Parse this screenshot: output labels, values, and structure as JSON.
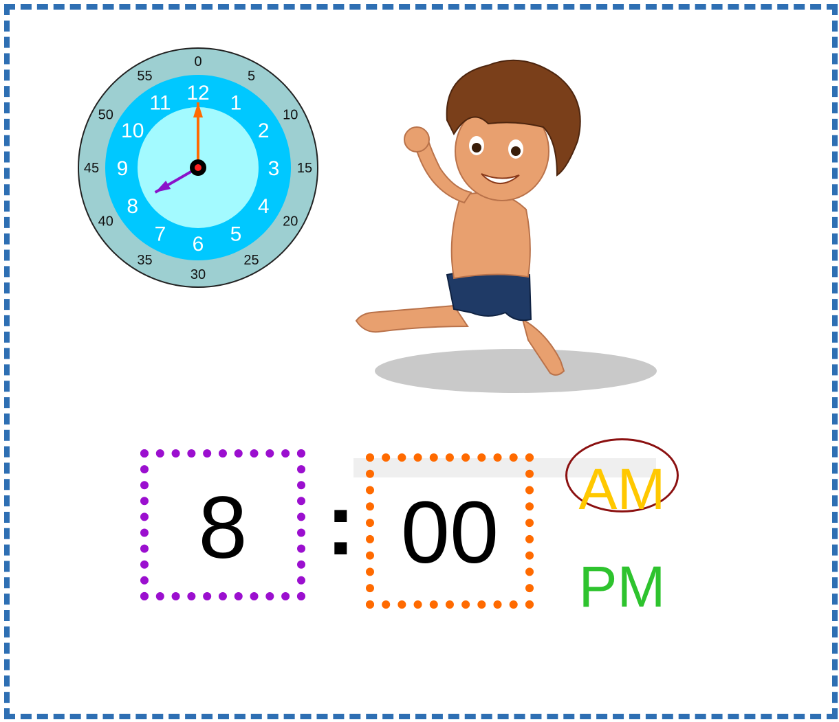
{
  "clock": {
    "hour_numbers": [
      "12",
      "1",
      "2",
      "3",
      "4",
      "5",
      "6",
      "7",
      "8",
      "9",
      "10",
      "11"
    ],
    "minute_numbers": [
      "0",
      "5",
      "10",
      "15",
      "20",
      "25",
      "30",
      "35",
      "40",
      "45",
      "50",
      "55"
    ],
    "hour_value": 8,
    "minute_value": 0,
    "colors": {
      "outer_ring": "#9dcfd1",
      "hour_ring": "#00c8ff",
      "face": "#a3faff",
      "hour_hand": "#8a12c9",
      "minute_hand": "#ff6a00"
    }
  },
  "illustration": "boy-running-icon",
  "time": {
    "hour": "8",
    "separator": ":",
    "minute": "00"
  },
  "period": {
    "am_label": "AM",
    "pm_label": "PM",
    "selected": "AM",
    "am_color": "#ffc800",
    "pm_color": "#2ec32e"
  },
  "colors": {
    "frame": "#2e6fb3",
    "hour_box": "#9b0fcf",
    "minute_box": "#ff6a00",
    "selection_ring": "#8b1010"
  }
}
